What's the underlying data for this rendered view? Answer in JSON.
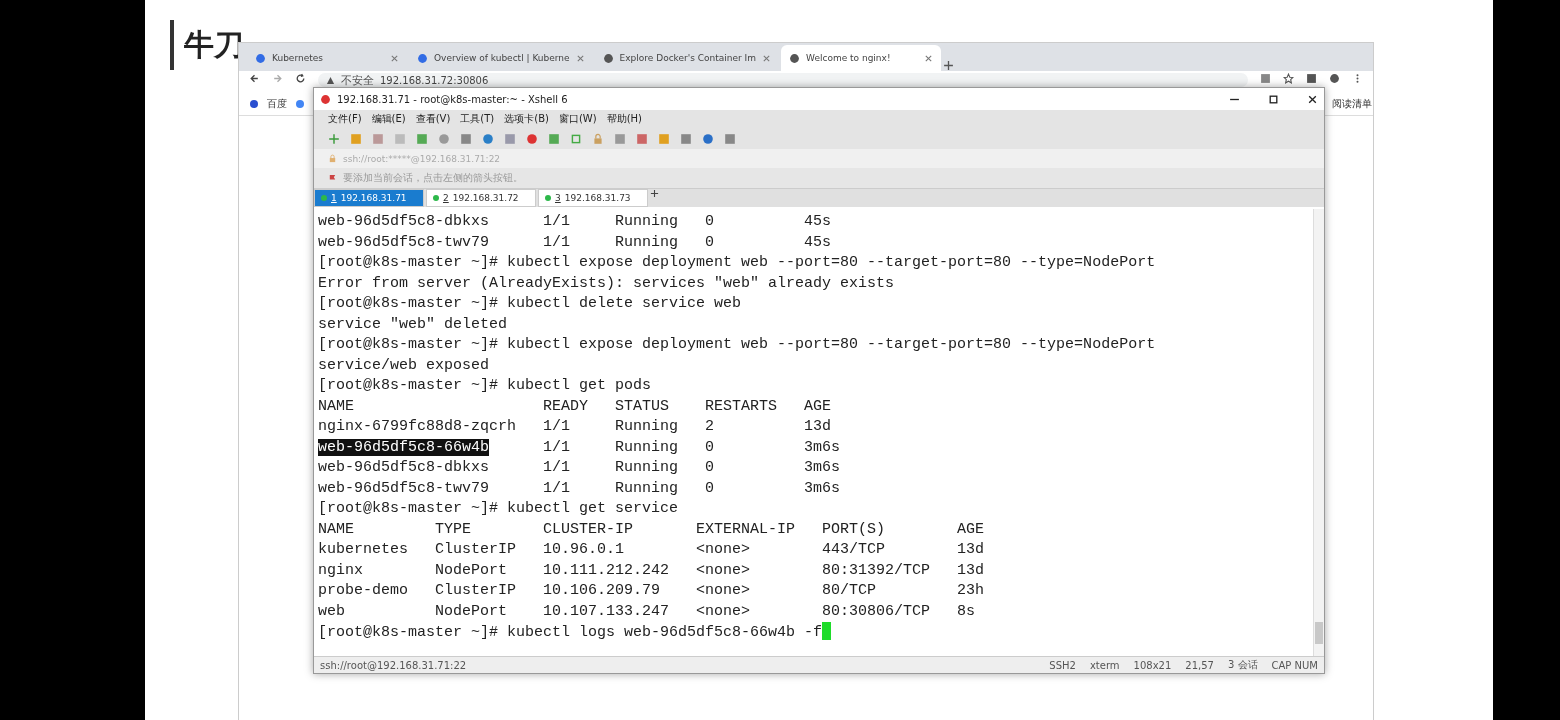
{
  "slide": {
    "title": "牛刀"
  },
  "browser": {
    "tabs": [
      {
        "label": "Kubernetes",
        "selected": false
      },
      {
        "label": "Overview of kubectl | Kuberne",
        "selected": false
      },
      {
        "label": "Explore Docker's Container Im",
        "selected": false
      },
      {
        "label": "Welcome to nginx!",
        "selected": true
      }
    ],
    "address": {
      "warning": "不安全",
      "url": "192.168.31.72:30806"
    },
    "bookmarks": [
      {
        "label": "百度"
      }
    ],
    "reading_list": "阅读清单"
  },
  "xshell": {
    "title": "192.168.31.71 - root@k8s-master:~ - Xshell 6",
    "menu": [
      "文件(F)",
      "编辑(E)",
      "查看(V)",
      "工具(T)",
      "选项卡(B)",
      "窗口(W)",
      "帮助(H)"
    ],
    "address": "ssh://root:*****@192.168.31.71:22",
    "notice": "要添加当前会话，点击左侧的箭头按钮。",
    "tabs": [
      {
        "number": "1",
        "label": "192.168.31.71",
        "selected": true
      },
      {
        "number": "2",
        "label": "192.168.31.72",
        "selected": false
      },
      {
        "number": "3",
        "label": "192.168.31.73",
        "selected": false
      }
    ],
    "terminal": {
      "cursor_visible": true,
      "lines": [
        {
          "kind": "plain",
          "text": "web-96d5df5c8-dbkxs      1/1     Running   0          45s"
        },
        {
          "kind": "plain",
          "text": "web-96d5df5c8-twv79      1/1     Running   0          45s"
        },
        {
          "kind": "plain",
          "text": "[root@k8s-master ~]# kubectl expose deployment web --port=80 --target-port=80 --type=NodePort"
        },
        {
          "kind": "plain",
          "text": "Error from server (AlreadyExists): services \"web\" already exists"
        },
        {
          "kind": "plain",
          "text": "[root@k8s-master ~]# kubectl delete service web"
        },
        {
          "kind": "plain",
          "text": "service \"web\" deleted"
        },
        {
          "kind": "plain",
          "text": "[root@k8s-master ~]# kubectl expose deployment web --port=80 --target-port=80 --type=NodePort"
        },
        {
          "kind": "plain",
          "text": "service/web exposed"
        },
        {
          "kind": "plain",
          "text": "[root@k8s-master ~]# kubectl get pods"
        },
        {
          "kind": "plain",
          "text": "NAME                     READY   STATUS    RESTARTS   AGE"
        },
        {
          "kind": "plain",
          "text": "nginx-6799fc88d8-zqcrh   1/1     Running   2          13d"
        },
        {
          "kind": "split",
          "parts": [
            {
              "text": "web-96d5df5c8-66w4b",
              "selected": true
            },
            {
              "text": "      1/1     Running   0          3m6s",
              "selected": false
            }
          ]
        },
        {
          "kind": "plain",
          "text": "web-96d5df5c8-dbkxs      1/1     Running   0          3m6s"
        },
        {
          "kind": "plain",
          "text": "web-96d5df5c8-twv79      1/1     Running   0          3m6s"
        },
        {
          "kind": "plain",
          "text": "[root@k8s-master ~]# kubectl get service"
        },
        {
          "kind": "plain",
          "text": "NAME         TYPE        CLUSTER-IP       EXTERNAL-IP   PORT(S)        AGE"
        },
        {
          "kind": "plain",
          "text": "kubernetes   ClusterIP   10.96.0.1        <none>        443/TCP        13d"
        },
        {
          "kind": "plain",
          "text": "nginx        NodePort    10.111.212.242   <none>        80:31392/TCP   13d"
        },
        {
          "kind": "plain",
          "text": "probe-demo   ClusterIP   10.106.209.79    <none>        80/TCP         23h"
        },
        {
          "kind": "plain",
          "text": "web          NodePort    10.107.133.247   <none>        80:30806/TCP   8s"
        },
        {
          "kind": "plain",
          "text": "[root@k8s-master ~]# kubectl logs web-96d5df5c8-66w4b -f"
        }
      ]
    },
    "status_bar": {
      "connection": "ssh://root@192.168.31.71:22",
      "items": [
        "SSH2",
        "xterm",
        "108x21",
        "21,57",
        "3 会话",
        "CAP NUM"
      ]
    }
  }
}
